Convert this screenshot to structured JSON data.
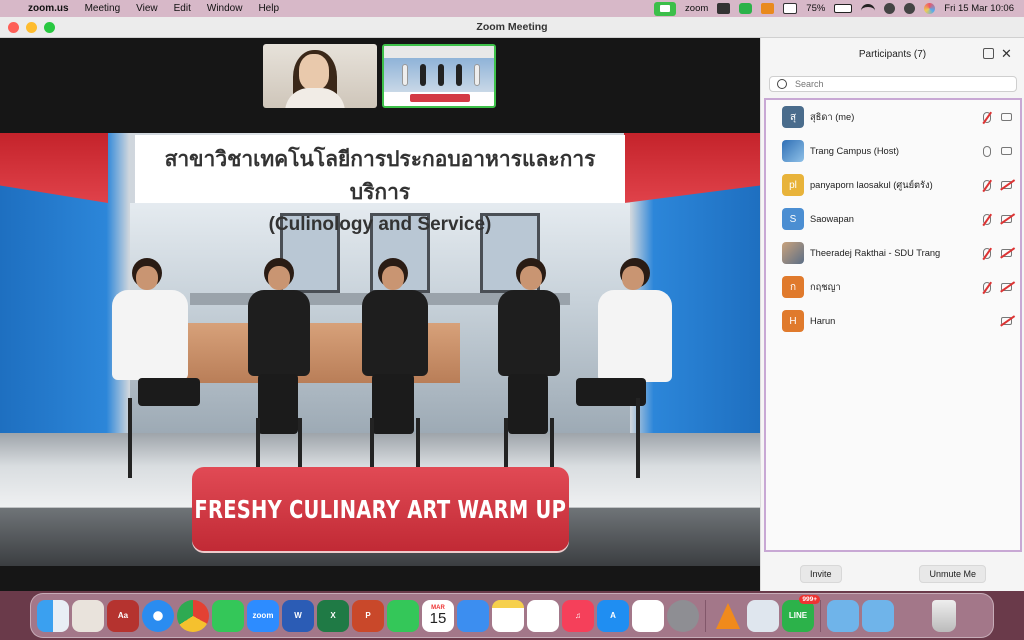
{
  "menubar": {
    "app": "zoom.us",
    "items": [
      "Meeting",
      "View",
      "Edit",
      "Window",
      "Help"
    ],
    "zoom_label": "zoom",
    "battery": "75%",
    "datetime": "Fri 15 Mar  10:06"
  },
  "window": {
    "title": "Zoom Meeting"
  },
  "stage": {
    "title_thai": "สาขาวิชาเทคโนโลยีการประกอบอาหารและการบริการ",
    "title_eng": "(Culinology and Service)",
    "banner": "FRESHY CULINARY ART WARM UP"
  },
  "participants": {
    "title": "Participants (7)",
    "search_placeholder": "Search",
    "list": [
      {
        "initial": "สุ",
        "name": "สุธิดา (me)",
        "color": "#4a6c8c",
        "mic": "muted",
        "cam": "on"
      },
      {
        "initial": "",
        "name": "Trang Campus (Host)",
        "color": "#2f6fb5",
        "mic": "on",
        "cam": "on"
      },
      {
        "initial": "pl",
        "name": "panyaporn laosakul (ศูนย์ตรัง)",
        "color": "#e8b33a",
        "mic": "muted",
        "cam": "off"
      },
      {
        "initial": "S",
        "name": "Saowapan",
        "color": "#4b8ed2",
        "mic": "muted",
        "cam": "off"
      },
      {
        "initial": "",
        "name": "Theeradej Rakthai - SDU Trang",
        "color": "#8a96a8",
        "mic": "muted",
        "cam": "off"
      },
      {
        "initial": "ก",
        "name": "กฤชญา",
        "color": "#e07a2c",
        "mic": "muted",
        "cam": "off"
      },
      {
        "initial": "H",
        "name": "Harun",
        "color": "#e07a2c",
        "mic": "none",
        "cam": "off"
      }
    ],
    "invite_label": "Invite",
    "unmute_label": "Unmute Me"
  },
  "dock": {
    "zoom_label": "zoom",
    "calendar_month": "MAR",
    "calendar_day": "15",
    "line_badge": "999+"
  },
  "colors": {
    "accent_green": "#3ec14a",
    "highlight": "#c8a8d4",
    "banner_red": "#d33a44"
  }
}
